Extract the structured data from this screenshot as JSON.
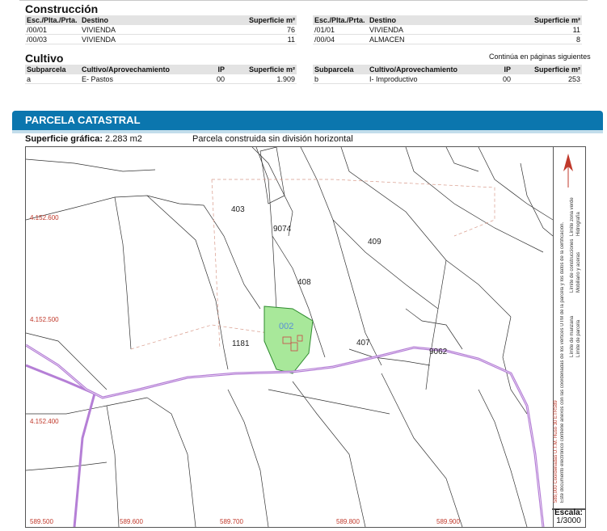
{
  "construccion": {
    "title": "Construcción",
    "headers": [
      "Esc./Plta./Prta.",
      "Destino",
      "Superficie m²"
    ],
    "left_rows": [
      {
        "esc": "/00/01",
        "destino": "VIVIENDA",
        "sup": "76"
      },
      {
        "esc": "/00/03",
        "destino": "VIVIENDA",
        "sup": "11"
      }
    ],
    "right_rows": [
      {
        "esc": "/01/01",
        "destino": "VIVIENDA",
        "sup": "11"
      },
      {
        "esc": "/00/04",
        "destino": "ALMACEN",
        "sup": "8"
      }
    ]
  },
  "continua": "Continúa en páginas siguientes",
  "cultivo": {
    "title": "Cultivo",
    "headers": [
      "Subparcela",
      "Cultivo/Aprovechamiento",
      "IP",
      "Superficie m²"
    ],
    "left_row": {
      "sub": "a",
      "cultivo": "E- Pastos",
      "ip": "00",
      "sup": "1.909"
    },
    "right_row": {
      "sub": "b",
      "cultivo": "I- Improductivo",
      "ip": "00",
      "sup": "253"
    }
  },
  "parcela": {
    "title": "PARCELA CATASTRAL",
    "superficie_label": "Superficie gráfica:",
    "superficie_value": "2.283 m2",
    "tipo": "Parcela construida sin división horizontal"
  },
  "map": {
    "parcel_labels": [
      "403",
      "9074",
      "409",
      "408",
      "002",
      "1181",
      "407",
      "9062"
    ],
    "utm_y": [
      "4.152.600",
      "4.152.500",
      "4.152.400"
    ],
    "utm_x": [
      "589.500",
      "589.600",
      "589.700",
      "589.800",
      "589.900"
    ],
    "highlight_color": "#a8e89a",
    "road_color": "#b57fd6"
  },
  "legend": {
    "items": [
      "Límite de manzana",
      "Límite de parcela",
      "Límite de construcciones",
      "Mobiliario y aceras",
      "Límite zona verde",
      "Hidrografía"
    ],
    "coords_note": "589,000 Coordenadas U.T.M. Huso 30 ETRS89",
    "doc_note": "Este documento electrónico contiene anexos con las coordenadas de los vértices UTM de la parcela y los datos de la certificación."
  },
  "escala": {
    "label": "Escala:",
    "value": "1/3000"
  }
}
